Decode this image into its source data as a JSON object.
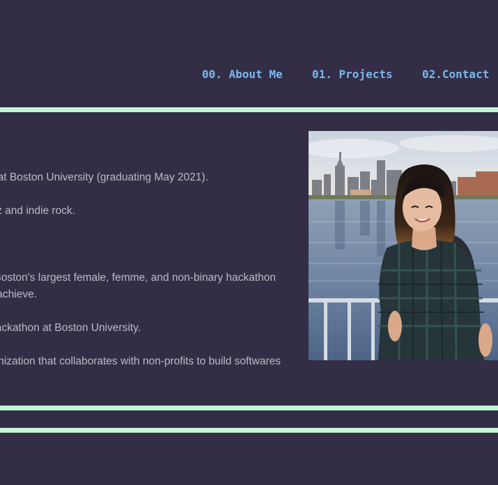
{
  "nav": {
    "items": [
      {
        "label": "00. About Me"
      },
      {
        "label": "01. Projects"
      },
      {
        "label": "02.Contact"
      }
    ]
  },
  "about": {
    "lines": [
      "I am a senior studying Computer Science at Boston University (graduating May 2021).",
      "In my free time I enjoy listening to jazz and indie rock.",
      "I am an organizer for Hack Beanpot, Boston's largest female, femme, and non-binary hackathon",
      "that empowers women and minorities to achieve.",
      "I was also a director of BU's largest hackathon at Boston University.",
      "I am a member of a student-run organization that collaborates with non-profits to build softwares"
    ]
  },
  "colors": {
    "background": "#332e45",
    "accent_rule": "#c4f6d2",
    "nav_link": "#7ab8f0",
    "body_text": "#bdbac6"
  },
  "photo": {
    "alt": "profile-photo"
  }
}
